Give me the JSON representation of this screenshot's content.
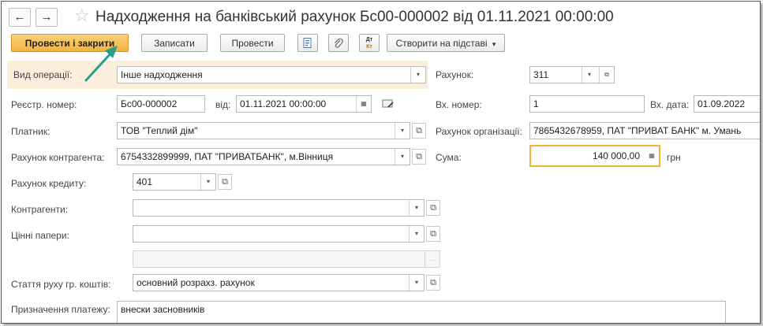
{
  "window": {
    "title": "Надходження на банківський рахунок Бс00-000002 від 01.11.2021 00:00:00",
    "back_icon": "←",
    "forward_icon": "→",
    "star_icon": "☆"
  },
  "toolbar": {
    "post_close": "Провести і закрити",
    "save": "Записати",
    "post": "Провести",
    "dt_kt_top": "Дт",
    "dt_kt_bottom": "Кт",
    "create_based": "Створити на підставі",
    "dropdown_arrow": "▾"
  },
  "form": {
    "operation_label": "Вид операції:",
    "operation_value": "Інше надходження",
    "account_label": "Рахунок:",
    "account_value": "311",
    "reg_label": "Реєстр. номер:",
    "reg_value": "Бс00-000002",
    "date_from_label": "від:",
    "date_value": "01.11.2021 00:00:00",
    "in_number_label": "Вх. номер:",
    "in_number_value": "1",
    "in_date_label": "Вх. дата:",
    "in_date_value": "01.09.2022",
    "payer_label": "Платник:",
    "payer_value": "ТОВ \"Теплий дім\"",
    "org_account_label": "Рахунок організації:",
    "org_account_value": "7865432678959, ПАТ \"ПРИВАТ БАНК\" м. Умань",
    "contractor_account_label": "Рахунок контрагента:",
    "contractor_account_value": "6754332899999, ПАТ \"ПРИВАТБАНК\", м.Вінниця",
    "sum_label": "Сума:",
    "sum_value": "140 000,00",
    "currency": "грн",
    "credit_account_label": "Рахунок кредиту:",
    "credit_account_value": "401",
    "contractors_label": "Контрагенти:",
    "contractors_value": "",
    "securities_label": "Цінні папери:",
    "securities_value": "",
    "extra_value": "",
    "ellipsis": "...",
    "cash_flow_label": "Стаття руху гр. коштів:",
    "cash_flow_value": "основний розрахз. рахунок",
    "purpose_label": "Призначення платежу:",
    "purpose_value": "внески засновників"
  },
  "colors": {
    "primary_button": "#f4b23e",
    "highlight_row": "#fbeedb",
    "arrow": "#2a9d8f",
    "focus_border": "#f0b43a"
  }
}
